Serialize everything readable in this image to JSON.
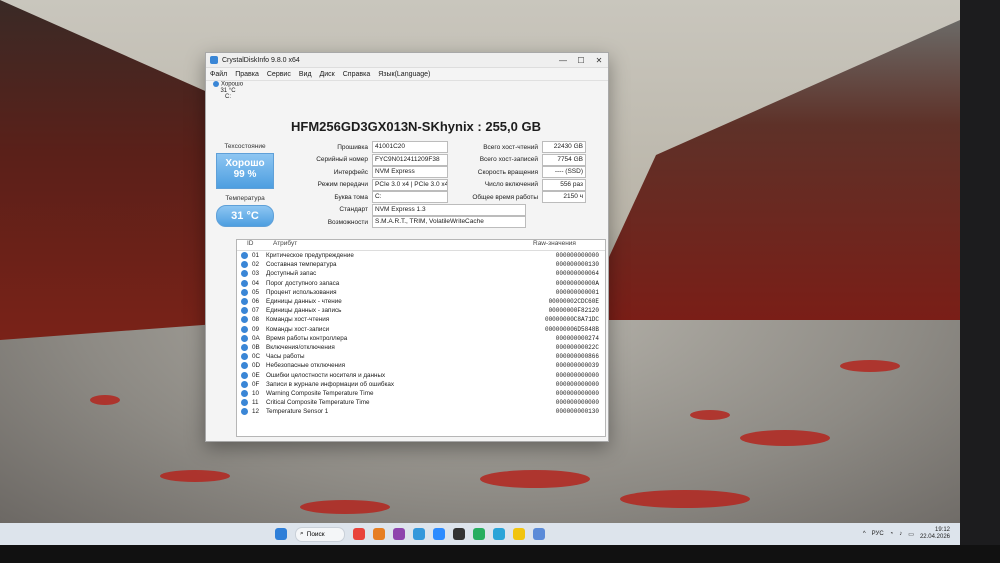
{
  "window": {
    "title": "CrystalDiskInfo 9.8.0 x64",
    "controls": {
      "minimize": "—",
      "maximize": "☐",
      "close": "✕"
    },
    "menu": [
      "Файл",
      "Правка",
      "Сервис",
      "Вид",
      "Диск",
      "Справка",
      "Язык(Language)"
    ],
    "disk_tab": {
      "status": "Хорошо",
      "temp": "31 °C",
      "letter": "C:"
    },
    "disk_title": "HFM256GD3GX013N-SKhynix : 255,0 GB",
    "health": {
      "label": "Техсостояние",
      "status": "Хорошо",
      "percent": "99 %"
    },
    "temperature": {
      "label": "Температура",
      "value": "31 °C"
    },
    "info_left": [
      {
        "k": "Прошивка",
        "v": "41001C20"
      },
      {
        "k": "Серийный номер",
        "v": "FYC9N012411209F38"
      },
      {
        "k": "Интерфейс",
        "v": "NVM Express"
      },
      {
        "k": "Режим передачи",
        "v": "PCIe 3.0 x4 | PCIe 3.0 x4"
      },
      {
        "k": "Буква тома",
        "v": "C:"
      }
    ],
    "info_right": [
      {
        "k": "Всего хост-чтений",
        "v": "22430 GB"
      },
      {
        "k": "Всего хост-записей",
        "v": "7754 GB"
      },
      {
        "k": "Скорость вращения",
        "v": "---- (SSD)"
      },
      {
        "k": "Число включений",
        "v": "556 раз"
      },
      {
        "k": "Общее время работы",
        "v": "2150 ч"
      }
    ],
    "standard": {
      "k": "Стандарт",
      "v": "NVM Express 1.3"
    },
    "features": {
      "k": "Возможности",
      "v": "S.M.A.R.T., TRIM, VolatileWriteCache"
    },
    "smart_headers": {
      "id": "ID",
      "attr": "Атрибут",
      "raw": "Raw-значения"
    },
    "smart": [
      {
        "id": "01",
        "name": "Критическое предупреждение",
        "raw": "000000000000"
      },
      {
        "id": "02",
        "name": "Составная температура",
        "raw": "000000000130"
      },
      {
        "id": "03",
        "name": "Доступный запас",
        "raw": "000000000064"
      },
      {
        "id": "04",
        "name": "Порог доступного запаса",
        "raw": "00000000000A"
      },
      {
        "id": "05",
        "name": "Процент использования",
        "raw": "000000000001"
      },
      {
        "id": "06",
        "name": "Единицы данных - чтение",
        "raw": "00000002CDC60E"
      },
      {
        "id": "07",
        "name": "Единицы данных - запись",
        "raw": "00000000F82120"
      },
      {
        "id": "08",
        "name": "Команды хост-чтения",
        "raw": "00000000C8A71DC"
      },
      {
        "id": "09",
        "name": "Команды хост-записи",
        "raw": "000000006D5848B"
      },
      {
        "id": "0A",
        "name": "Время работы контроллера",
        "raw": "000000000274"
      },
      {
        "id": "0B",
        "name": "Включения/отключения",
        "raw": "00000000022C"
      },
      {
        "id": "0C",
        "name": "Часы работы",
        "raw": "000000000866"
      },
      {
        "id": "0D",
        "name": "Небезопасные отключения",
        "raw": "000000000039"
      },
      {
        "id": "0E",
        "name": "Ошибки целостности носителя и данных",
        "raw": "000000000000"
      },
      {
        "id": "0F",
        "name": "Записи в журнале информации об ошибках",
        "raw": "000000000000"
      },
      {
        "id": "10",
        "name": "Warning Composite Temperature Time",
        "raw": "000000000000"
      },
      {
        "id": "11",
        "name": "Critical Composite Temperature Time",
        "raw": "000000000000"
      },
      {
        "id": "12",
        "name": "Temperature Sensor 1",
        "raw": "000000000130"
      }
    ]
  },
  "taskbar": {
    "search_label": "Поиск",
    "language": "РУС",
    "time": "19:12",
    "date": "22.04.2026"
  },
  "colors": {
    "accent": "#3a86d6"
  }
}
